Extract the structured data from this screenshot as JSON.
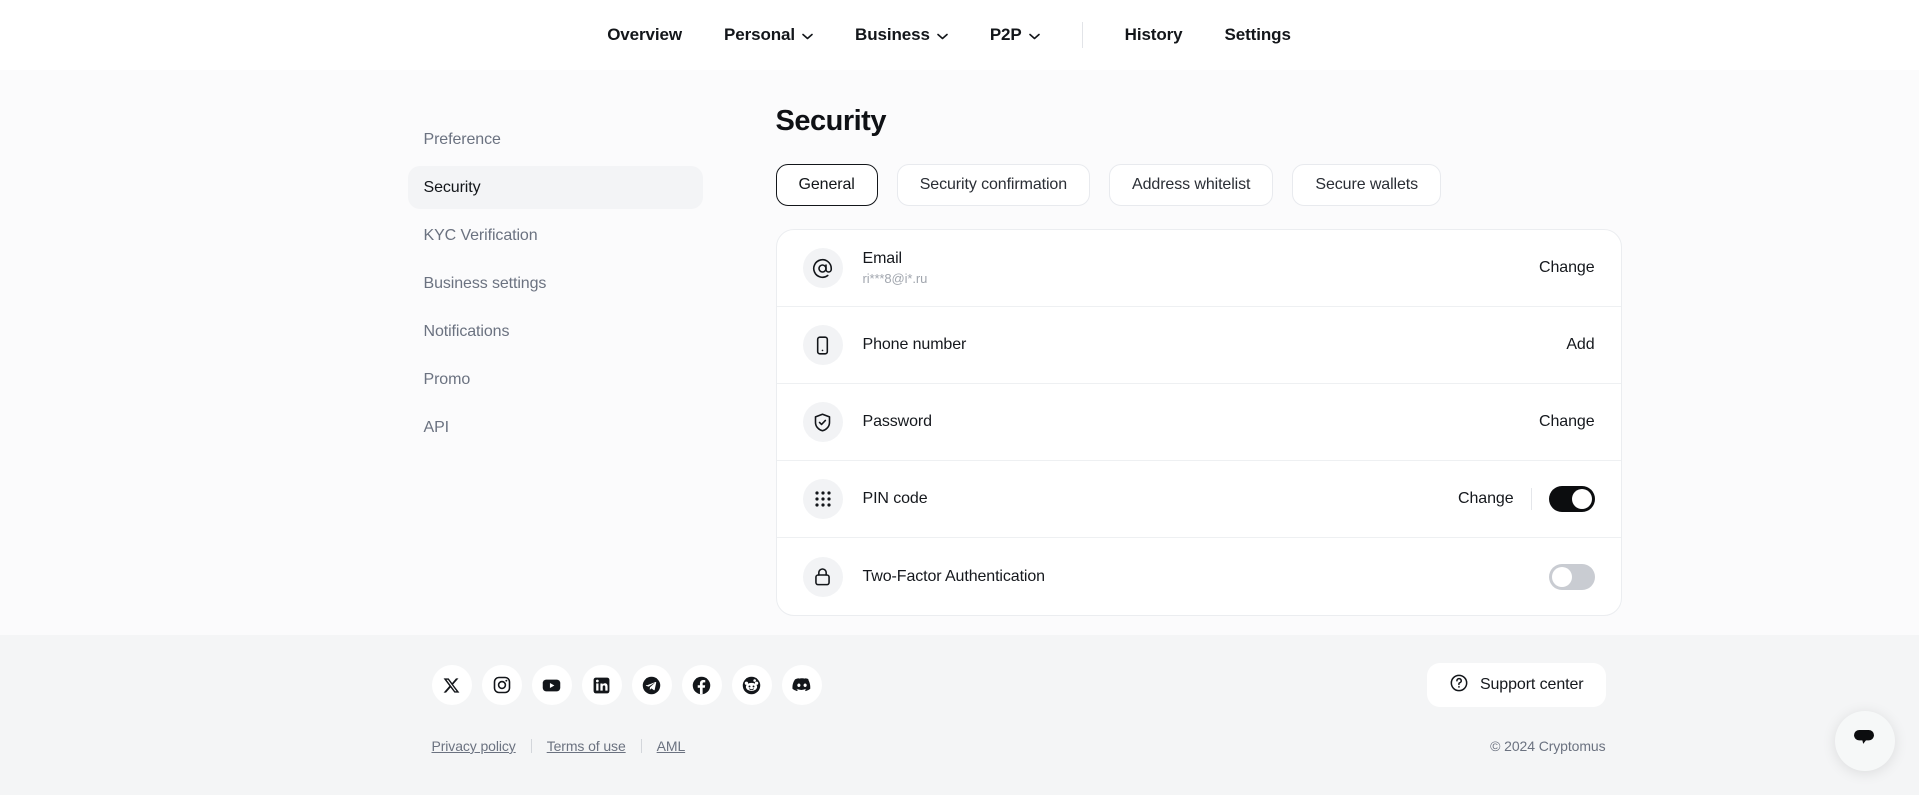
{
  "header": {
    "nav": [
      {
        "label": "Overview",
        "has_chevron": false
      },
      {
        "label": "Personal",
        "has_chevron": true
      },
      {
        "label": "Business",
        "has_chevron": true
      },
      {
        "label": "P2P",
        "has_chevron": true
      },
      {
        "label": "History",
        "has_chevron": false
      },
      {
        "label": "Settings",
        "has_chevron": false
      }
    ]
  },
  "sidebar": {
    "items": [
      {
        "label": "Preference",
        "active": false
      },
      {
        "label": "Security",
        "active": true
      },
      {
        "label": "KYC Verification",
        "active": false
      },
      {
        "label": "Business settings",
        "active": false
      },
      {
        "label": "Notifications",
        "active": false
      },
      {
        "label": "Promo",
        "active": false
      },
      {
        "label": "API",
        "active": false
      }
    ]
  },
  "main": {
    "title": "Security",
    "tabs": [
      {
        "label": "General",
        "active": true
      },
      {
        "label": "Security confirmation",
        "active": false
      },
      {
        "label": "Address whitelist",
        "active": false
      },
      {
        "label": "Secure wallets",
        "active": false
      }
    ],
    "rows": [
      {
        "icon": "at-icon",
        "label": "Email",
        "sub": "ri***8@i*.ru",
        "action": "Change",
        "toggle": null
      },
      {
        "icon": "smartphone-icon",
        "label": "Phone number",
        "sub": "",
        "action": "Add",
        "toggle": null
      },
      {
        "icon": "shield-check-icon",
        "label": "Password",
        "sub": "",
        "action": "Change",
        "toggle": null
      },
      {
        "icon": "dot-grid-icon",
        "label": "PIN code",
        "sub": "",
        "action": "Change",
        "toggle": "on"
      },
      {
        "icon": "lock-icon",
        "label": "Two-Factor Authentication",
        "sub": "",
        "action": "",
        "toggle": "off"
      }
    ]
  },
  "footer": {
    "socials": [
      {
        "name": "x-icon",
        "label": "X"
      },
      {
        "name": "instagram-icon",
        "label": "Instagram"
      },
      {
        "name": "youtube-icon",
        "label": "YouTube"
      },
      {
        "name": "linkedin-icon",
        "label": "LinkedIn"
      },
      {
        "name": "telegram-icon",
        "label": "Telegram"
      },
      {
        "name": "facebook-icon",
        "label": "Facebook"
      },
      {
        "name": "reddit-icon",
        "label": "Reddit"
      },
      {
        "name": "discord-icon",
        "label": "Discord"
      }
    ],
    "support_label": "Support center",
    "legal": [
      {
        "label": "Privacy policy"
      },
      {
        "label": "Terms of use"
      },
      {
        "label": "AML"
      }
    ],
    "copyright": "© 2024 Cryptomus"
  },
  "chat": {
    "icon": "chat-bubble-icon"
  },
  "colors": {
    "page_bg": "#fbfbfc",
    "footer_bg": "#f4f5f6",
    "accent": "#0c0d0f",
    "muted_text": "#6b7280",
    "toggle_off": "#c9ccd2"
  }
}
